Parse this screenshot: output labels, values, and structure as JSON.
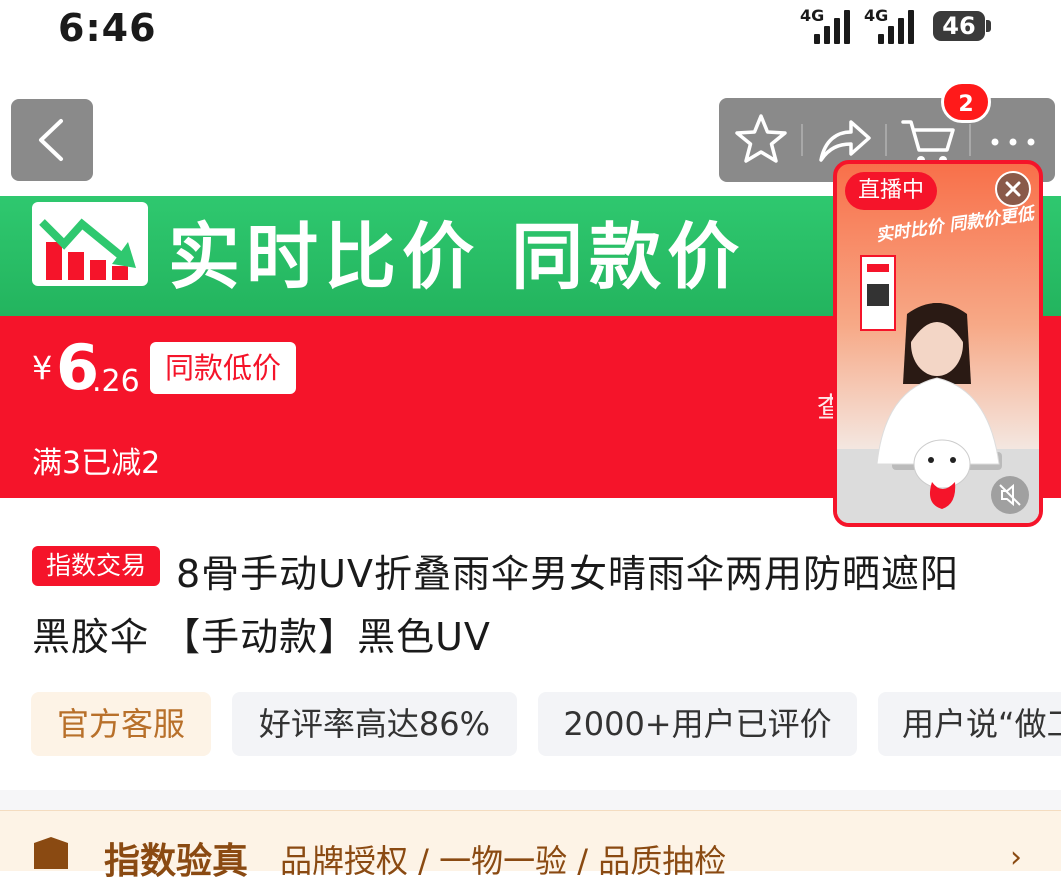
{
  "status_bar": {
    "time": "6:46",
    "signal_1_label": "4G",
    "signal_2_label": "4G",
    "battery": "46"
  },
  "nav": {
    "cart_count": "2"
  },
  "banner": {
    "text": "实时比价 同款价"
  },
  "price": {
    "yen": "¥",
    "integer": "6",
    "decimal": ".26",
    "tag": "同款低价",
    "discount": "满3已减2",
    "side_char": "查"
  },
  "live": {
    "badge": "直播中",
    "slogan": "实时比价 同款价更低"
  },
  "product": {
    "tag": "指数交易",
    "title_line1": "8骨手动UV折叠雨伞男女晴雨伞两用防晒遮阳",
    "title_line2": "黑胶伞 【手动款】黑色UV"
  },
  "chips": [
    {
      "label": "官方客服"
    },
    {
      "label": "好评率高达86%"
    },
    {
      "label": "2000+用户已评价"
    },
    {
      "label": "用户说“做工"
    }
  ],
  "bottom": {
    "title": "指数验真",
    "desc": "品牌授权 / 一物一验 / 品质抽检"
  },
  "colors": {
    "accent_red": "#f5142a",
    "banner_green": "#2fc86f",
    "chip_orange_text": "#b8702a"
  }
}
